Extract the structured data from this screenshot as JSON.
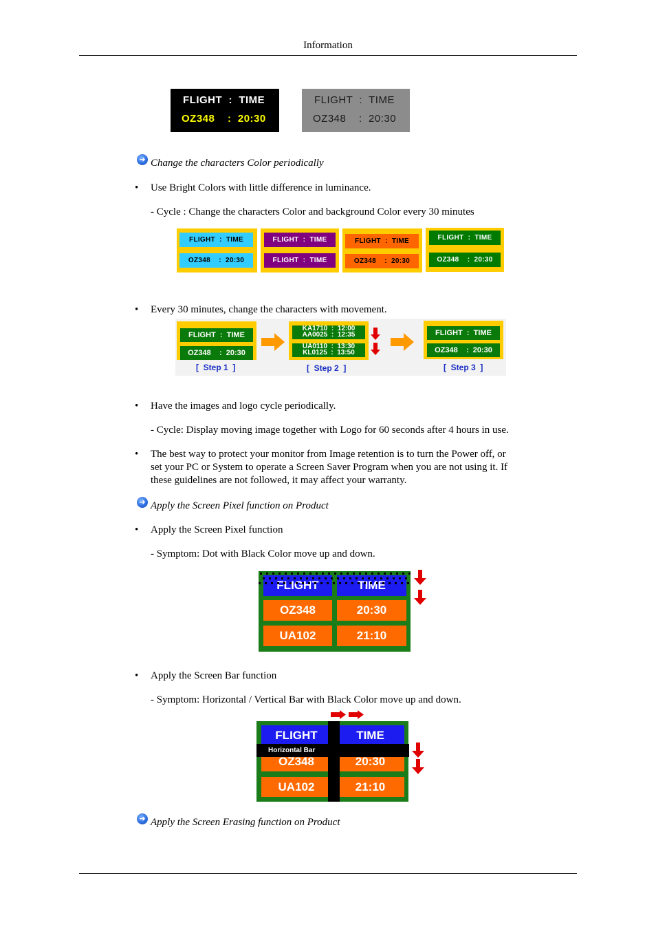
{
  "header": {
    "title": "Information"
  },
  "top_boards": {
    "black": {
      "line1": "FLIGHT  :  TIME",
      "line2": "OZ348    :  20:30",
      "line1_color": "#ffffff",
      "line2_color": "#ffff00"
    },
    "gray": {
      "line1": "FLIGHT  :  TIME",
      "line2": "OZ348    :  20:30",
      "text_color": "#1a1a1a"
    }
  },
  "sections": {
    "color_cycle": {
      "heading": "Change the characters Color periodically",
      "bullet": "Use Bright Colors with little difference in luminance.",
      "note": "- Cycle : Change the characters Color and background Color every 30 minutes",
      "boards": [
        {
          "row1": "FLIGHT  :  TIME",
          "row2": "OZ348    :  20:30",
          "bg": "#33ccff",
          "fg": "#000000"
        },
        {
          "row1": "FLIGHT  :  TIME",
          "row2": "FLIGHT  :  TIME",
          "bg": "#800080",
          "fg": "#ffffff"
        },
        {
          "row1": "FLIGHT  :  TIME",
          "row2": "OZ348    :  20:30",
          "bg": "#ff6600",
          "fg": "#000000"
        },
        {
          "row1": "FLIGHT  :  TIME",
          "row2": "OZ348    :  20:30",
          "bg": "#007a00",
          "fg": "#ffffff"
        }
      ]
    },
    "movement": {
      "bullet": "Every 30 minutes, change the characters with movement.",
      "steps": [
        {
          "label": "[  Step 1  ]",
          "row1": "FLIGHT  :  TIME",
          "row2": "OZ348    :  20:30"
        },
        {
          "label": "[  Step 2  ]",
          "row1a": "KA1710  :  12:00",
          "row1b": "AA0025  :  12:35",
          "row2a": "UA0110  :  13:30",
          "row2b": "KL0125  :  13:50"
        },
        {
          "label": "[  Step 3  ]",
          "row1": "FLIGHT  :  TIME",
          "row2": "OZ348    :  20:30"
        }
      ]
    },
    "logo_cycle": {
      "bullet": "Have the images and logo cycle periodically.",
      "note": "- Cycle: Display moving image together with Logo for 60 seconds after 4 hours in use."
    },
    "power_off": {
      "lines": [
        "The best way to protect your monitor from Image retention is to turn the Power off, or",
        "set your PC or System to operate a Screen Saver Program when you are not using it. If",
        "these guidelines are not followed, it may affect your warranty."
      ]
    },
    "screen_pixel": {
      "heading": "Apply the Screen Pixel function on Product",
      "bullet": "Apply the Screen Pixel function",
      "note": "- Symptom: Dot with Black Color move up and down.",
      "board": {
        "h1": "FLIGHT",
        "h2": "TIME",
        "r1c1": "OZ348",
        "r1c2": "20:30",
        "r2c1": "UA102",
        "r2c2": "21:10"
      }
    },
    "screen_bar": {
      "bullet": "Apply the Screen Bar function",
      "note": "- Symptom: Horizontal / Vertical Bar with Black Color move up and down.",
      "board": {
        "h1": "FLIGHT",
        "h2": "TIME",
        "r1c1": "OZ348",
        "r1c2": "20:30",
        "r2c1": "UA102",
        "r2c2": "21:10",
        "bar_label": "Horizontal Bar"
      }
    },
    "screen_erasing": {
      "heading": "Apply the Screen Erasing function on Product"
    }
  },
  "icons": {
    "section_marker": "arrow-right-circle-icon",
    "bullet": "bullet-dot"
  },
  "colors": {
    "accent_blue": "#2f6fe0",
    "board_yellow": "#ffcc00",
    "board_green": "#0a7a0a",
    "arrow_orange": "#ff9900",
    "arrow_red": "#e00000",
    "step_label": "#1a2fc4"
  },
  "bullet_char": "•"
}
